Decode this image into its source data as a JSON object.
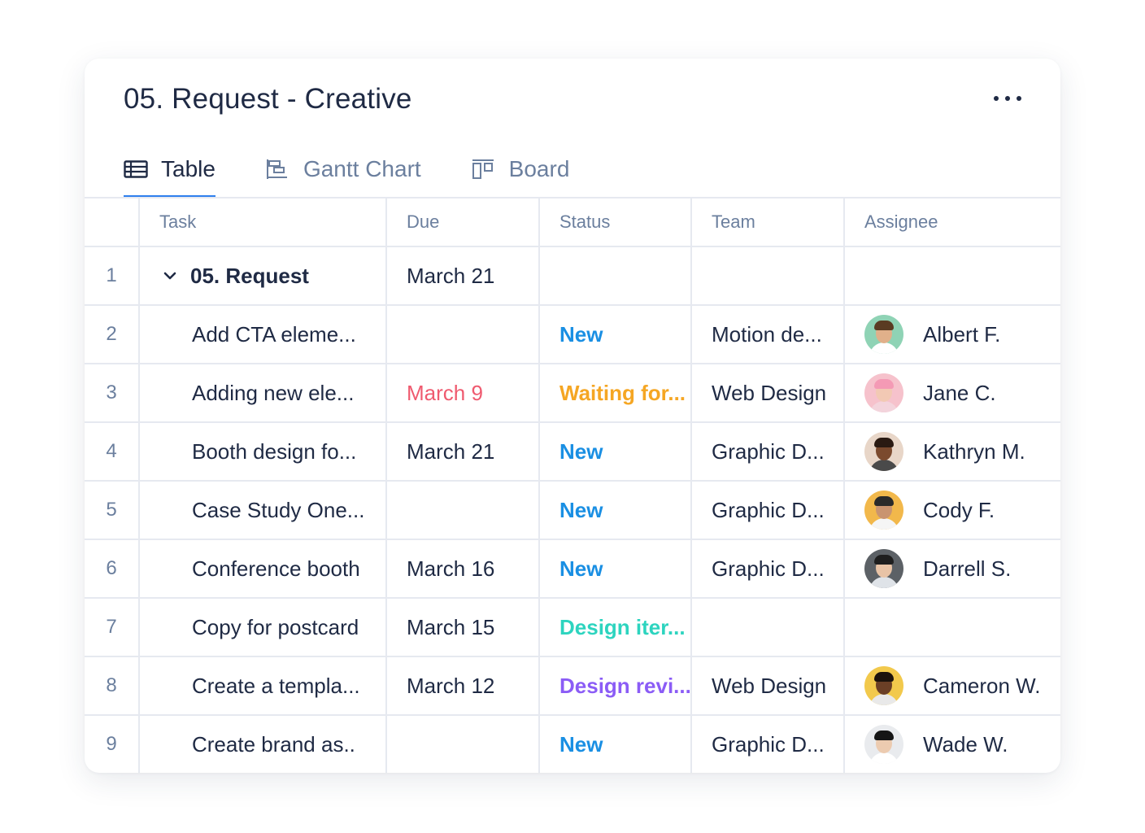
{
  "board": {
    "title": "05. Request - Creative",
    "more_icon": "more-horizontal-icon"
  },
  "tabs": [
    {
      "label": "Table",
      "icon": "table-icon",
      "active": true
    },
    {
      "label": "Gantt Chart",
      "icon": "gantt-chart-icon",
      "active": false
    },
    {
      "label": "Board",
      "icon": "board-icon",
      "active": false
    }
  ],
  "columns": {
    "task": "Task",
    "due": "Due",
    "status": "Status",
    "team": "Team",
    "assignee": "Assignee"
  },
  "colors": {
    "accent": "#2f80ed",
    "status_new": "#1a8fe3",
    "status_waiting": "#f5a623",
    "status_design_iteration": "#2dd4bf",
    "status_design_review": "#8b5cf6",
    "overdue": "#ef5a6f"
  },
  "rows": [
    {
      "num": "1",
      "task": "05. Request",
      "due": "March 21",
      "status": "",
      "team": "",
      "assignee": "",
      "group": true
    },
    {
      "num": "2",
      "task": "Add CTA eleme...",
      "due": "",
      "status": "New",
      "status_color": "#1a8fe3",
      "team": "Motion de...",
      "assignee": "Albert F.",
      "avatar_bg": "#8fd3b5",
      "skin": "#e0b08a",
      "hair": "#5a3b22",
      "shirt": "#ffffff"
    },
    {
      "num": "3",
      "task": "Adding new ele...",
      "due": "March 9",
      "due_overdue": true,
      "status": "Waiting for...",
      "status_color": "#f5a623",
      "team": "Web Design",
      "assignee": "Jane C.",
      "avatar_bg": "#f6c2cc",
      "skin": "#f2c9b4",
      "hair": "#f49ab5",
      "shirt": "#f3d4dc"
    },
    {
      "num": "4",
      "task": "Booth design fo...",
      "due": "March 21",
      "status": "New",
      "status_color": "#1a8fe3",
      "team": "Graphic D...",
      "assignee": "Kathryn M.",
      "avatar_bg": "#e8d6c8",
      "skin": "#7b4a2e",
      "hair": "#2a1a12",
      "shirt": "#4a4a4a"
    },
    {
      "num": "5",
      "task": "Case Study One...",
      "due": "",
      "status": "New",
      "status_color": "#1a8fe3",
      "team": "Graphic D...",
      "assignee": "Cody F.",
      "avatar_bg": "#f2b84b",
      "skin": "#c99470",
      "hair": "#2a2a2a",
      "shirt": "#f5f5f5"
    },
    {
      "num": "6",
      "task": "Conference booth",
      "due": "March 16",
      "status": "New",
      "status_color": "#1a8fe3",
      "team": "Graphic D...",
      "assignee": "Darrell S.",
      "avatar_bg": "#5c6166",
      "skin": "#e8c3a6",
      "hair": "#1e1e1e",
      "shirt": "#dfe3e8"
    },
    {
      "num": "7",
      "task": "Copy for postcard",
      "due": "March 15",
      "status": "Design iter...",
      "status_color": "#2dd4bf",
      "team": "",
      "assignee": ""
    },
    {
      "num": "8",
      "task": "Create a templa...",
      "due": "March 12",
      "status": "Design revi...",
      "status_color": "#8b5cf6",
      "team": "Web Design",
      "assignee": "Cameron W.",
      "avatar_bg": "#f2c94c",
      "skin": "#6b3f26",
      "hair": "#1c120c",
      "shirt": "#e9e9e9"
    },
    {
      "num": "9",
      "task": "Create brand as..",
      "due": "",
      "status": "New",
      "status_color": "#1a8fe3",
      "team": "Graphic D...",
      "assignee": "Wade W.",
      "avatar_bg": "#e9ebee",
      "skin": "#eccbb0",
      "hair": "#151515",
      "shirt": "#ffffff"
    }
  ]
}
